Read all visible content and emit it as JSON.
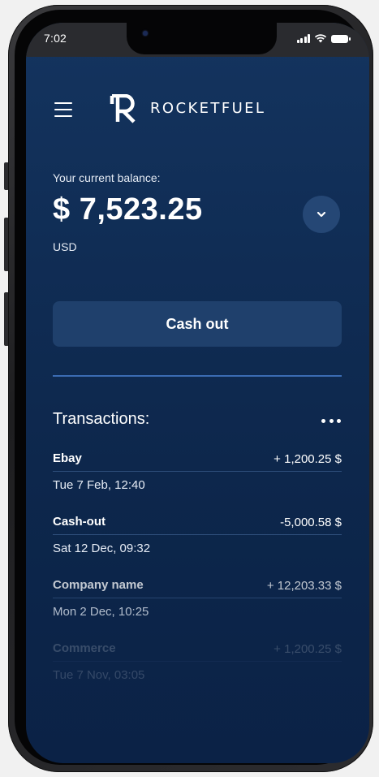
{
  "status_bar": {
    "time": "7:02",
    "icons": [
      "signal-icon",
      "wifi-icon",
      "battery-icon"
    ]
  },
  "header": {
    "menu_icon": "hamburger-menu-icon",
    "logo_text": "ROCKETFUEL"
  },
  "balance": {
    "label": "Your current balance:",
    "amount": "$ 7,523.25",
    "currency": "USD",
    "expand_icon": "chevron-down-icon"
  },
  "actions": {
    "cash_out_label": "Cash out"
  },
  "transactions": {
    "title": "Transactions:",
    "more_icon": "more-horizontal-icon",
    "items": [
      {
        "name": "Ebay",
        "amount": "+ 1,200.25 $",
        "date": "Tue 7 Feb, 12:40"
      },
      {
        "name": "Cash-out",
        "amount": "-5,000.58 $",
        "date": "Sat 12 Dec, 09:32"
      },
      {
        "name": "Company name",
        "amount": "+ 12,203.33 $",
        "date": "Mon 2 Dec, 10:25"
      },
      {
        "name": "Commerce",
        "amount": "+ 1,200.25 $",
        "date": "Tue 7 Nov, 03:05"
      }
    ]
  },
  "colors": {
    "background_top": "#14345f",
    "background_bottom": "#0b2246",
    "button_bg": "#1f406c",
    "divider": "#3b6cb3",
    "text": "#ffffff"
  }
}
